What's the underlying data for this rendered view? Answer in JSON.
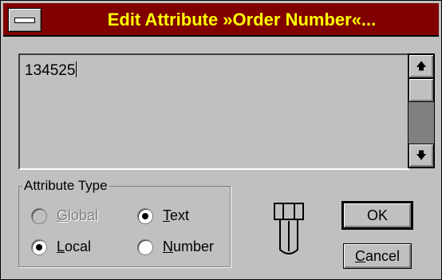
{
  "window": {
    "title": "Edit Attribute »Order Number«...",
    "system_menu_icon": "system-menu-icon"
  },
  "editor": {
    "value": "134525"
  },
  "scrollbar": {
    "up_glyph": "🡅",
    "down_glyph": "🡇"
  },
  "attribute_type": {
    "legend": "Attribute Type",
    "options": [
      {
        "mn": "G",
        "rest": "lobal",
        "checked": false,
        "enabled": false
      },
      {
        "mn": "T",
        "rest": "ext",
        "checked": true,
        "enabled": true
      },
      {
        "mn": "L",
        "rest": "ocal",
        "checked": true,
        "enabled": true
      },
      {
        "mn": "N",
        "rest": "umber",
        "checked": false,
        "enabled": true
      }
    ]
  },
  "buttons": {
    "ok": "OK",
    "cancel_mn": "C",
    "cancel_rest": "ancel"
  },
  "icons": {
    "bolt": "bolt-icon"
  }
}
